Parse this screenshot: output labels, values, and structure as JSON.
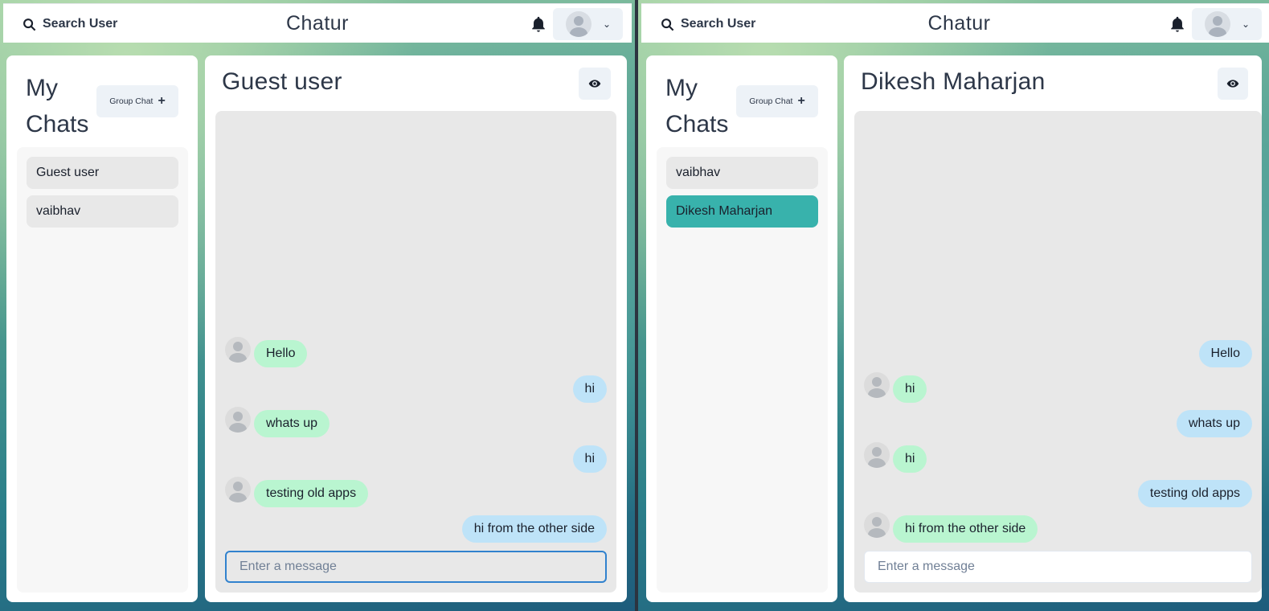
{
  "left": {
    "search_label": "Search User",
    "app_title": "Chatur",
    "chats_title": "My Chats",
    "group_chat_label": "Group Chat",
    "chats": [
      {
        "name": "Guest user",
        "active": false
      },
      {
        "name": "vaibhav",
        "active": false
      }
    ],
    "conversation_title": "Guest user",
    "messages": [
      {
        "text": "Hello",
        "dir": "in"
      },
      {
        "text": "hi",
        "dir": "out"
      },
      {
        "text": "whats up",
        "dir": "in"
      },
      {
        "text": "hi",
        "dir": "out"
      },
      {
        "text": "testing old apps",
        "dir": "in"
      },
      {
        "text": "hi from the other side",
        "dir": "out"
      }
    ],
    "input_placeholder": "Enter a message"
  },
  "right": {
    "search_label": "Search User",
    "app_title": "Chatur",
    "chats_title": "My Chats",
    "group_chat_label": "Group Chat",
    "chats": [
      {
        "name": "vaibhav",
        "active": false
      },
      {
        "name": "Dikesh Maharjan",
        "active": true
      }
    ],
    "conversation_title": "Dikesh Maharjan",
    "messages": [
      {
        "text": "Hello",
        "dir": "out"
      },
      {
        "text": "hi",
        "dir": "in"
      },
      {
        "text": "whats up",
        "dir": "out"
      },
      {
        "text": "hi",
        "dir": "in"
      },
      {
        "text": "testing old apps",
        "dir": "out"
      },
      {
        "text": "hi from the other side",
        "dir": "in"
      }
    ],
    "input_placeholder": "Enter a message"
  },
  "colors": {
    "active_chat": "#38b2ac",
    "incoming_bubble": "#b9f5d0",
    "outgoing_bubble": "#bee3f8",
    "input_focus": "#3182ce"
  },
  "icons": {
    "search": "search-icon",
    "bell": "bell-icon",
    "eye": "eye-icon",
    "chevron": "chevron-down-icon",
    "plus": "plus-icon"
  }
}
